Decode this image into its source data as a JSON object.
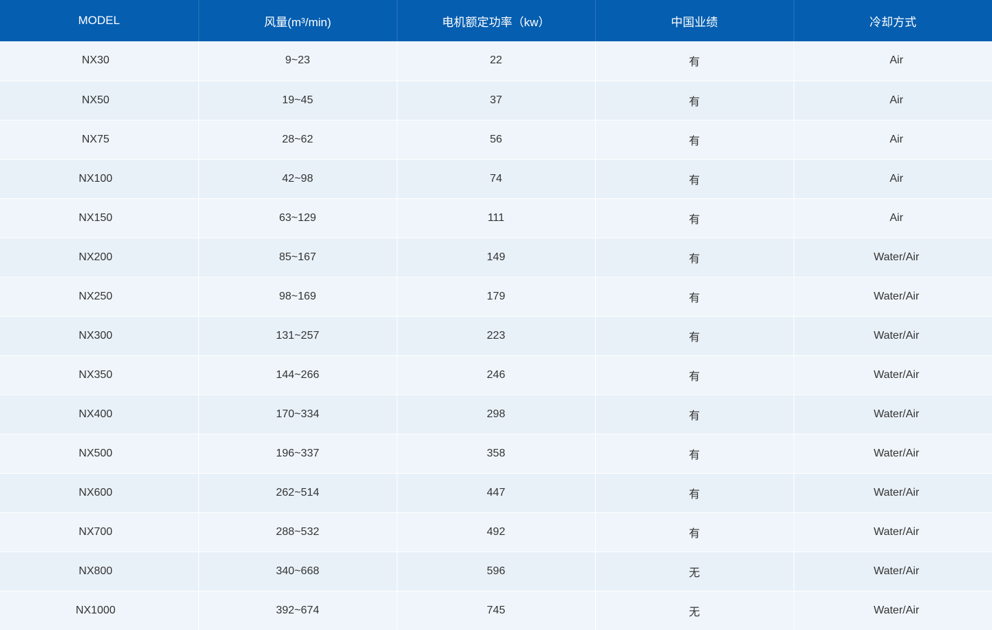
{
  "table": {
    "headers": [
      "MODEL",
      "风量(m³/min)",
      "电机额定功率（kw）",
      "中国业绩",
      "冷却方式"
    ],
    "rows": [
      [
        "NX30",
        "9~23",
        "22",
        "有",
        "Air"
      ],
      [
        "NX50",
        "19~45",
        "37",
        "有",
        "Air"
      ],
      [
        "NX75",
        "28~62",
        "56",
        "有",
        "Air"
      ],
      [
        "NX100",
        "42~98",
        "74",
        "有",
        "Air"
      ],
      [
        "NX150",
        "63~129",
        "111",
        "有",
        "Air"
      ],
      [
        "NX200",
        "85~167",
        "149",
        "有",
        "Water/Air"
      ],
      [
        "NX250",
        "98~169",
        "179",
        "有",
        "Water/Air"
      ],
      [
        "NX300",
        "131~257",
        "223",
        "有",
        "Water/Air"
      ],
      [
        "NX350",
        "144~266",
        "246",
        "有",
        "Water/Air"
      ],
      [
        "NX400",
        "170~334",
        "298",
        "有",
        "Water/Air"
      ],
      [
        "NX500",
        "196~337",
        "358",
        "有",
        "Water/Air"
      ],
      [
        "NX600",
        "262~514",
        "447",
        "有",
        "Water/Air"
      ],
      [
        "NX700",
        "288~532",
        "492",
        "有",
        "Water/Air"
      ],
      [
        "NX800",
        "340~668",
        "596",
        "无",
        "Water/Air"
      ],
      [
        "NX1000",
        "392~674",
        "745",
        "无",
        "Water/Air"
      ]
    ]
  },
  "colors": {
    "header_background": "#055eb0",
    "header_text": "#ffffff",
    "row_background_odd": "#eff5fa",
    "row_background_even": "#e9f1f8",
    "cell_text": "#333333"
  }
}
